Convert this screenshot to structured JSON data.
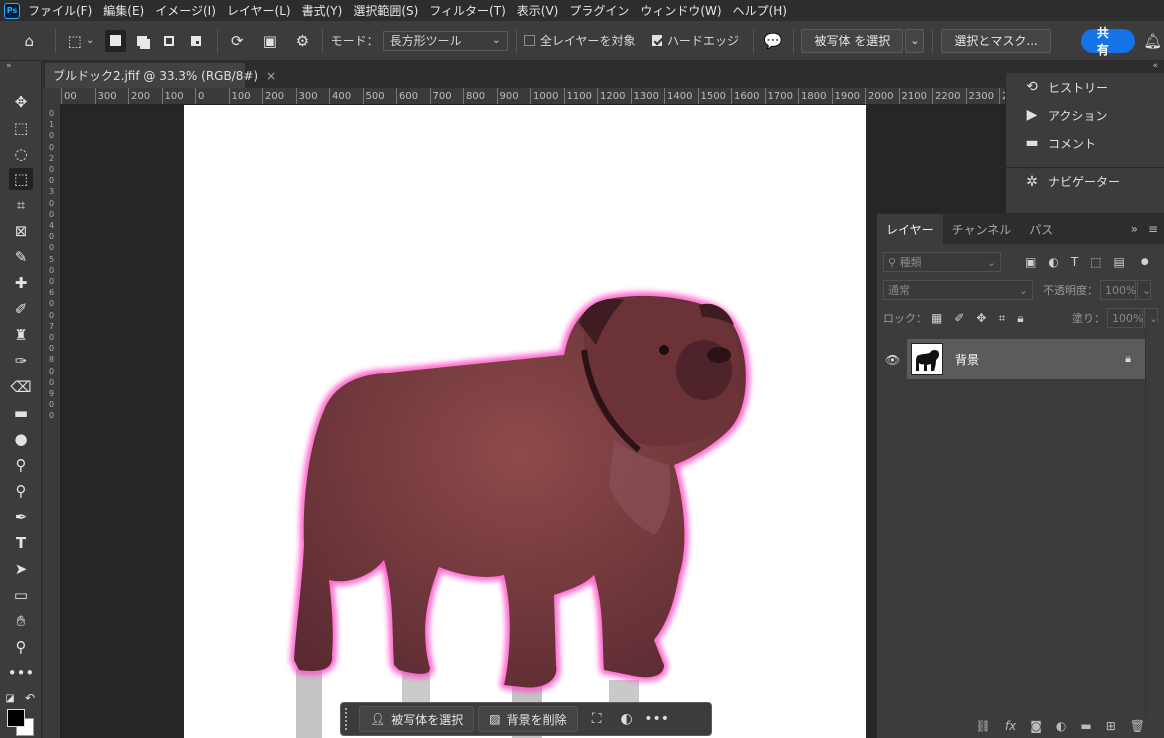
{
  "app": {
    "logo_text": "Ps"
  },
  "menu": [
    "ファイル(F)",
    "編集(E)",
    "イメージ(I)",
    "レイヤー(L)",
    "書式(Y)",
    "選択範囲(S)",
    "フィルター(T)",
    "表示(V)",
    "プラグイン",
    "ウィンドウ(W)",
    "ヘルプ(H)"
  ],
  "options": {
    "mode_label": "モード：",
    "mode_value": "長方形ツール",
    "all_layers_label": "全レイヤーを対象",
    "all_layers_checked": false,
    "hard_edge_label": "ハードエッジ",
    "hard_edge_checked": true,
    "select_subject_label": "被写体 を選択",
    "select_mask_label": "選択とマスク...",
    "share_label": "共有"
  },
  "document": {
    "tab_title": "ブルドック2.jfif @ 33.3% (RGB/8#)",
    "close_glyph": "×"
  },
  "ruler_h": [
    "00",
    "300",
    "200",
    "100",
    "0",
    "100",
    "200",
    "300",
    "400",
    "500",
    "600",
    "700",
    "800",
    "900",
    "1000",
    "1100",
    "1200",
    "1300",
    "1400",
    "1500",
    "1600",
    "1700",
    "1800",
    "1900",
    "2000",
    "2100",
    "2200",
    "2300",
    "2"
  ],
  "ruler_v": [
    "0",
    "1",
    "0",
    "0",
    "2",
    "0",
    "0",
    "3",
    "0",
    "0",
    "4",
    "0",
    "0",
    "5",
    "0",
    "0",
    "6",
    "0",
    "0",
    "7",
    "0",
    "0",
    "8",
    "0",
    "0",
    "9",
    "0",
    "0"
  ],
  "taskbar": {
    "select_subject": "被写体を選択",
    "remove_bg": "背景を削除"
  },
  "right_panels": [
    {
      "icon": "history-icon",
      "label": "ヒストリー"
    },
    {
      "icon": "play-icon",
      "label": "アクション"
    },
    {
      "icon": "comment-icon",
      "label": "コメント"
    },
    {
      "icon": "navigator-icon",
      "label": "ナビゲーター"
    }
  ],
  "layers": {
    "tabs": [
      "レイヤー",
      "チャンネル",
      "パス"
    ],
    "search_placeholder": "種類",
    "blend_mode": "通常",
    "opacity_label": "不透明度：",
    "opacity_value": "100%",
    "lock_label": "ロック：",
    "fill_label": "塗り：",
    "fill_value": "100%",
    "items": [
      {
        "name": "背景",
        "locked": true,
        "visible": true
      }
    ]
  },
  "colors": {
    "accent": "#1473e6",
    "selection_glow": "#ff4fc8",
    "dog_tint": "#7a3a3f"
  }
}
